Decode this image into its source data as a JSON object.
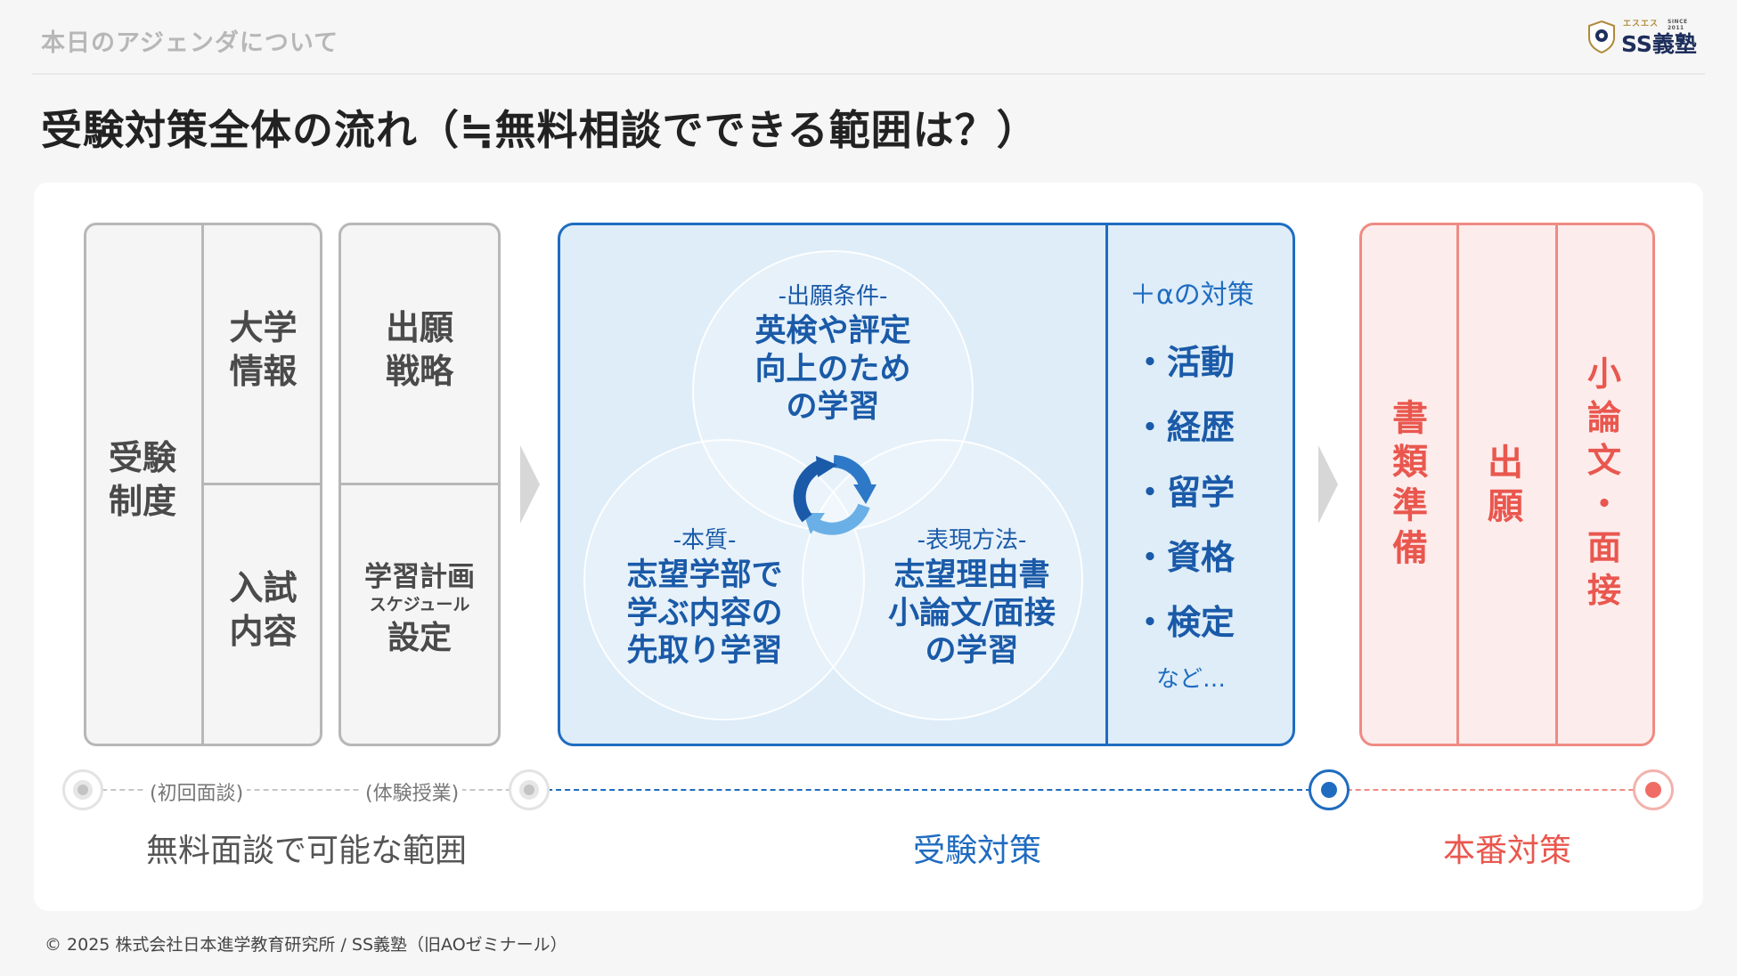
{
  "header": {
    "section_title": "本日のアジェンダについて"
  },
  "logo": {
    "kana": "エスエス",
    "since": "SINCE 2011",
    "name": "SS義塾"
  },
  "title": "受験対策全体の流れ（≒無料相談でできる範囲は？）",
  "free_section": {
    "system": "受験\n制度",
    "univ_info": "大学\n情報",
    "exam_content": "入試\n内容",
    "strategy": "出願\n戦略",
    "plan_line1": "学習計画",
    "plan_line2": "スケジュール",
    "plan_line3": "設定"
  },
  "venn": {
    "top": {
      "caption": "-出願条件-",
      "main": "英検や評定\n向上のため\nの学習"
    },
    "left": {
      "caption": "-本質-",
      "main": "志望学部で\n学ぶ内容の\n先取り学習"
    },
    "right": {
      "caption": "-表現方法-",
      "main": "志望理由書\n小論文/面接\nの学習"
    }
  },
  "alpha": {
    "title": "＋αの対策",
    "items": [
      "・活動",
      "・経歴",
      "・留学",
      "・資格",
      "・検定"
    ],
    "etc": "など…"
  },
  "final": {
    "docs": "書\n類\n準\n備",
    "apply": "出\n願",
    "essay": "小\n論\n文\n・\n面\n接"
  },
  "timeline": {
    "label1": "(初回面談)",
    "label2": "(体験授業)"
  },
  "phases": {
    "free": "無料面談で可能な範囲",
    "prep": "受験対策",
    "final": "本番対策"
  },
  "footer": "© 2025 株式会社日本進学教育研究所 / SS義塾（旧AOゼミナール）",
  "colors": {
    "blue": "#1f6cc0",
    "red": "#e9574e",
    "gray": "#b7b7b7"
  },
  "icons": [
    "cycle-arrows-icon",
    "crest-icon"
  ]
}
